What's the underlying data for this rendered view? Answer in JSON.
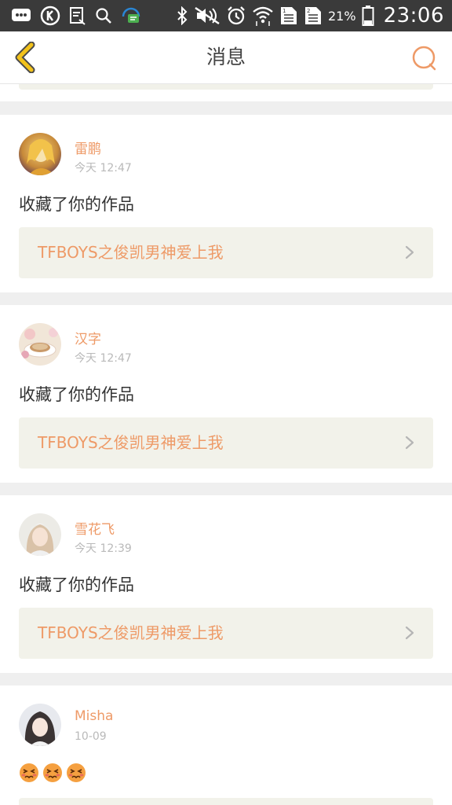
{
  "status_bar": {
    "icons_left": [
      "message-icon",
      "k-app-icon",
      "clipboard-icon",
      "search-icon",
      "notification-icon"
    ],
    "icons_right": [
      "bluetooth-icon",
      "mute-icon",
      "alarm-icon",
      "wifi-icon",
      "sim1-icon",
      "sim2-icon",
      "battery-icon"
    ],
    "battery_percent": "21%",
    "time": "23:06"
  },
  "header": {
    "title": "消息",
    "back_icon": "chevron-left-icon",
    "right_icon": "chat-bubble-icon"
  },
  "messages": [
    {
      "user": "雷鹏",
      "time": "今天 12:47",
      "text": "收藏了你的作品",
      "work_title": "TFBOYS之俊凯男神爱上我"
    },
    {
      "user": "汉字",
      "time": "今天 12:47",
      "text": "收藏了你的作品",
      "work_title": "TFBOYS之俊凯男神爱上我"
    },
    {
      "user": "雪花飞",
      "time": "今天 12:39",
      "text": "收藏了你的作品",
      "work_title": "TFBOYS之俊凯男神爱上我"
    },
    {
      "user": "Misha",
      "time": "10-09",
      "emoji": "😣😣😣"
    }
  ],
  "colors": {
    "accent": "#ee9a67",
    "back_arrow": "#e8b400",
    "status_bar": "#3a3a3a",
    "link_box": "#f2f2ea",
    "page_bg": "#efefef"
  }
}
